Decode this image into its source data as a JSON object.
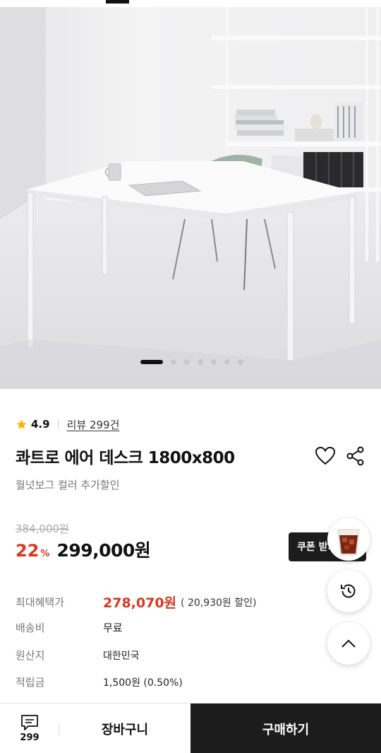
{
  "rating": {
    "value": "4.9",
    "review_link": "리뷰 299건"
  },
  "product": {
    "title": "콰트로 에어 데스크 1800x800",
    "subtitle": "월넛보그 컬러 추가할인",
    "original_price": "384,000원",
    "discount": "22",
    "discount_unit": "%",
    "sale_price": "299,000원"
  },
  "coupon": {
    "label": "쿠폰 받기"
  },
  "info": {
    "benefit_label": "최대혜택가",
    "benefit_price": "278,070원",
    "benefit_note": "( 20,930원 할인)",
    "shipping_label": "배송비",
    "shipping_value": "무료",
    "origin_label": "원산지",
    "origin_value": "대한민국",
    "points_label": "적립금",
    "points_value": "1,500원 (0.50%)"
  },
  "gallery": {
    "total_images": 7,
    "current_index": 1
  },
  "bottom_bar": {
    "chat_count": "299",
    "cart_label": "장바구니",
    "buy_label": "구매하기"
  },
  "colors": {
    "accent": "#d9381e",
    "dark": "#1c1c1c",
    "star": "#f5b800"
  }
}
